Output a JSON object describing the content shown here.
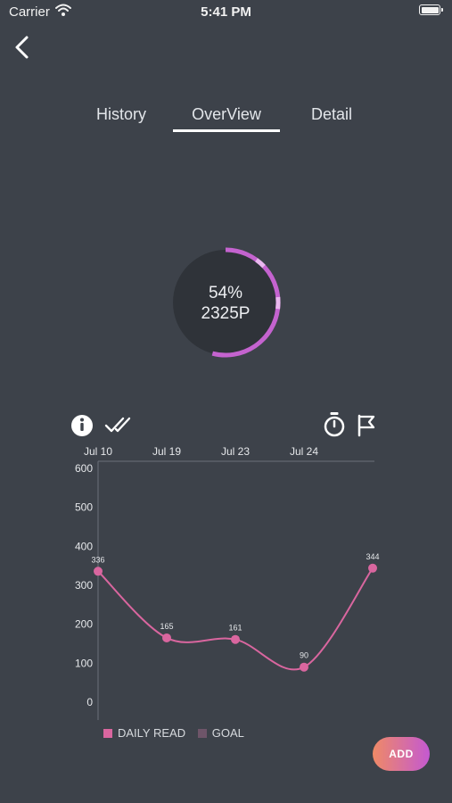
{
  "status_bar": {
    "carrier": "Carrier",
    "time": "5:41 PM"
  },
  "tabs": [
    {
      "label": "History",
      "active": false
    },
    {
      "label": "OverView",
      "active": true
    },
    {
      "label": "Detail",
      "active": false
    }
  ],
  "progress": {
    "percent_label": "54%",
    "pages_label": "2325P",
    "value": 0.54
  },
  "toolbar": {
    "icons": [
      "info-icon",
      "double-check-icon",
      "stopwatch-icon",
      "flag-icon"
    ]
  },
  "chart_data": {
    "type": "line",
    "x": [
      "Jul 10",
      "Jul 19",
      "Jul 23",
      "Jul 24",
      ""
    ],
    "series": [
      {
        "name": "DAILY READ",
        "values": [
          336,
          165,
          161,
          90,
          344
        ],
        "color": "#d9669f"
      },
      {
        "name": "GOAL",
        "values": [],
        "color": "#6e5569"
      }
    ],
    "yticks": [
      600,
      500,
      400,
      300,
      200,
      100,
      0
    ],
    "ylim": [
      0,
      600
    ],
    "grid": false,
    "legend": "bottom"
  },
  "add_button": {
    "label": "ADD"
  },
  "colors": {
    "background": "#3d424a",
    "accent": "#d9669f",
    "ring": "#c463cf"
  }
}
